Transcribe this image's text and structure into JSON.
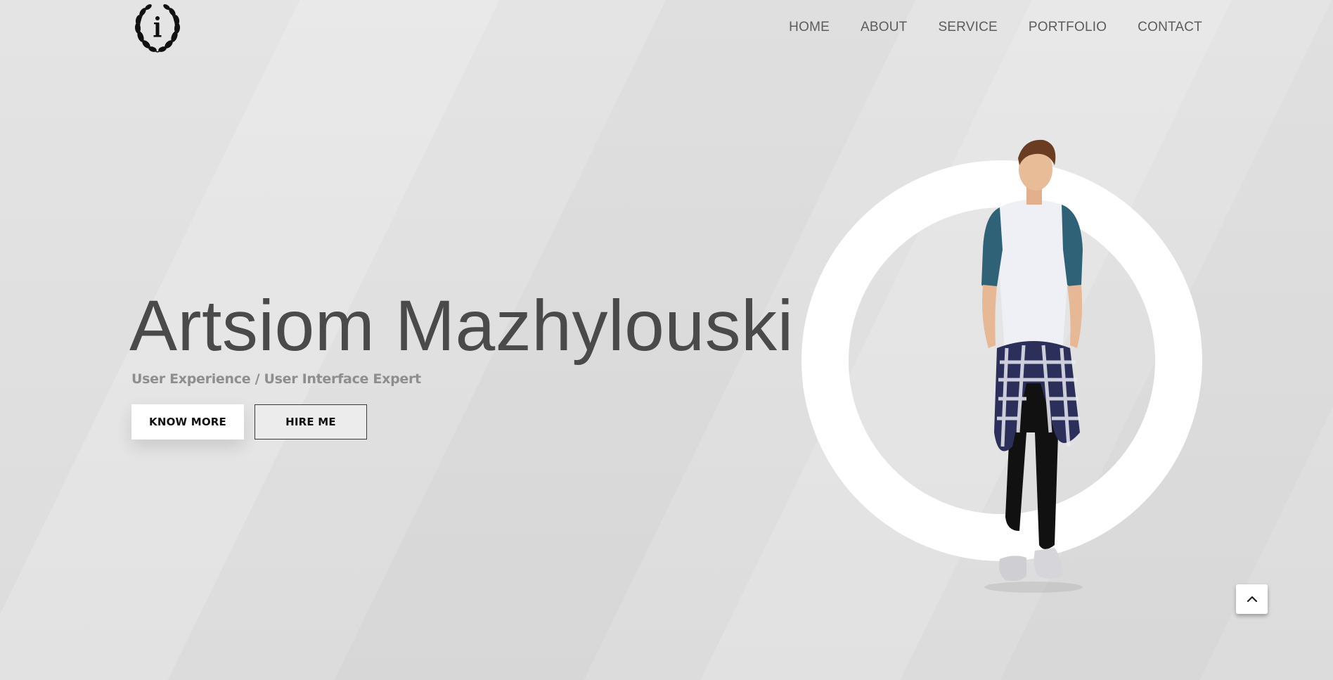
{
  "nav": {
    "items": [
      {
        "label": "HOME"
      },
      {
        "label": "ABOUT"
      },
      {
        "label": "SERVICE"
      },
      {
        "label": "PORTFOLIO"
      },
      {
        "label": "CONTACT"
      }
    ]
  },
  "hero": {
    "title": "Artsiom Mazhylouski",
    "subtitle": "User Experience / User Interface Expert",
    "know_more_label": "KNOW MORE",
    "hire_me_label": "HIRE ME"
  },
  "logo": {
    "letter": "i"
  },
  "icons": {
    "logo": "laurel-wreath-icon",
    "scroll_top": "chevron-up-icon"
  },
  "colors": {
    "background": "#e2e2e2",
    "title": "#4a4a4a",
    "subtitle": "#8e8e8e",
    "nav": "#5c5c5c",
    "ring": "#ffffff"
  }
}
